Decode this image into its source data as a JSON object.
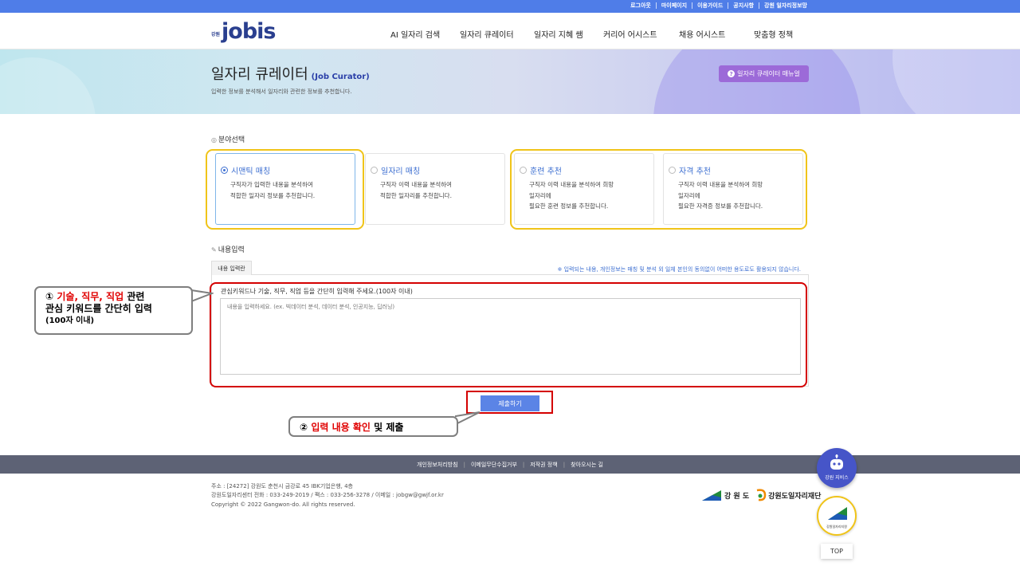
{
  "util_links": [
    "로그아웃",
    "마이페이지",
    "이용가이드",
    "공지사항",
    "강원 일자리정보망"
  ],
  "logo": {
    "prefix": "강원",
    "name": "jobis"
  },
  "nav": [
    "AI 일자리 검색",
    "일자리 큐레이터",
    "일자리 지혜 쌤",
    "커리어 어시스트",
    "채용 어시스트",
    "맞춤형 정책"
  ],
  "hero": {
    "title": "일자리 큐레이터",
    "subtitle_en": "(Job Curator)",
    "description": "입력한 정보를 분석해서 일자리와 관련한 정보를 추천합니다.",
    "manual_button": "일자리 큐레이터 매뉴얼"
  },
  "field_section": {
    "title": "분야선택",
    "cards": [
      {
        "title": "시맨틱 매칭",
        "desc": [
          "구직자가 입력한 내용을 분석하여",
          "적합한 일자리 정보를 추천합니다."
        ],
        "selected": true
      },
      {
        "title": "일자리 매칭",
        "desc": [
          "구직자 이력 내용을 분석하여",
          "적합한 일자리를 추천합니다."
        ],
        "selected": false
      },
      {
        "title": "훈련 추천",
        "desc": [
          "구직자 이력 내용을 분석하여 희망",
          "일자리에",
          "필요한 훈련 정보를 추천합니다."
        ],
        "selected": false
      },
      {
        "title": "자격 추천",
        "desc": [
          "구직자 이력 내용을 분석하여 희망",
          "일자리에",
          "필요한 자격증 정보를 추천합니다."
        ],
        "selected": false
      }
    ]
  },
  "input_section": {
    "title": "내용입력",
    "tab": "내용 입력란",
    "notice": "※ 입력되는 내용, 개인정보는 매칭 및 분석 외 일체 본인의 동의없이 어떠한 용도로도 활용되지 않습니다.",
    "label": "관심키워드나 기술, 직무, 직업 등을 간단히 입력해 주세요.(100자 이내)",
    "placeholder": "내용을 입력하세요. (ex. 빅데이터 분석, 데이터 분석, 인공지능, 딥러닝)",
    "value": "",
    "submit": "제출하기"
  },
  "callout1": {
    "num": "①",
    "kw1": "기술",
    "kw2": "직무",
    "kw3": "직업",
    "line1_tail": "관련",
    "line2": "관심 키워드를 간단히 입력",
    "line3": "(100자 이내)"
  },
  "callout2": {
    "num": "②",
    "highlight": "입력 내용 확인",
    "tail": "및 제출"
  },
  "footer": {
    "links": [
      "개인정보처리방침",
      "이메일무단수집거부",
      "저작권 정책",
      "찾아오시는 길"
    ],
    "address": "주소 : [24272] 강원도 춘천시 금강로 45 IBK기업은행, 4층",
    "contact": "강원도일자리센터 전화 : 033-249-2019 / 팩스 : 033-256-3278 / 이메일 : jobgw@gwjf.or.kr",
    "copyright": "Copyright © 2022 Gangwon-do. All rights reserved.",
    "logo_gw": "강 원 도",
    "logo_gj": "강원도일자리재단"
  },
  "side": {
    "robot_label": "강원 지비스",
    "emblem_label": "강원일자리지원",
    "top": "TOP"
  },
  "colors": {
    "topbar": "#4f7de8",
    "accent_blue": "#3d6fd1",
    "manual_purple": "#9c6ad8",
    "highlight_yellow": "#f0c419",
    "highlight_red": "#d40000",
    "footer_bar": "#5d6275"
  }
}
